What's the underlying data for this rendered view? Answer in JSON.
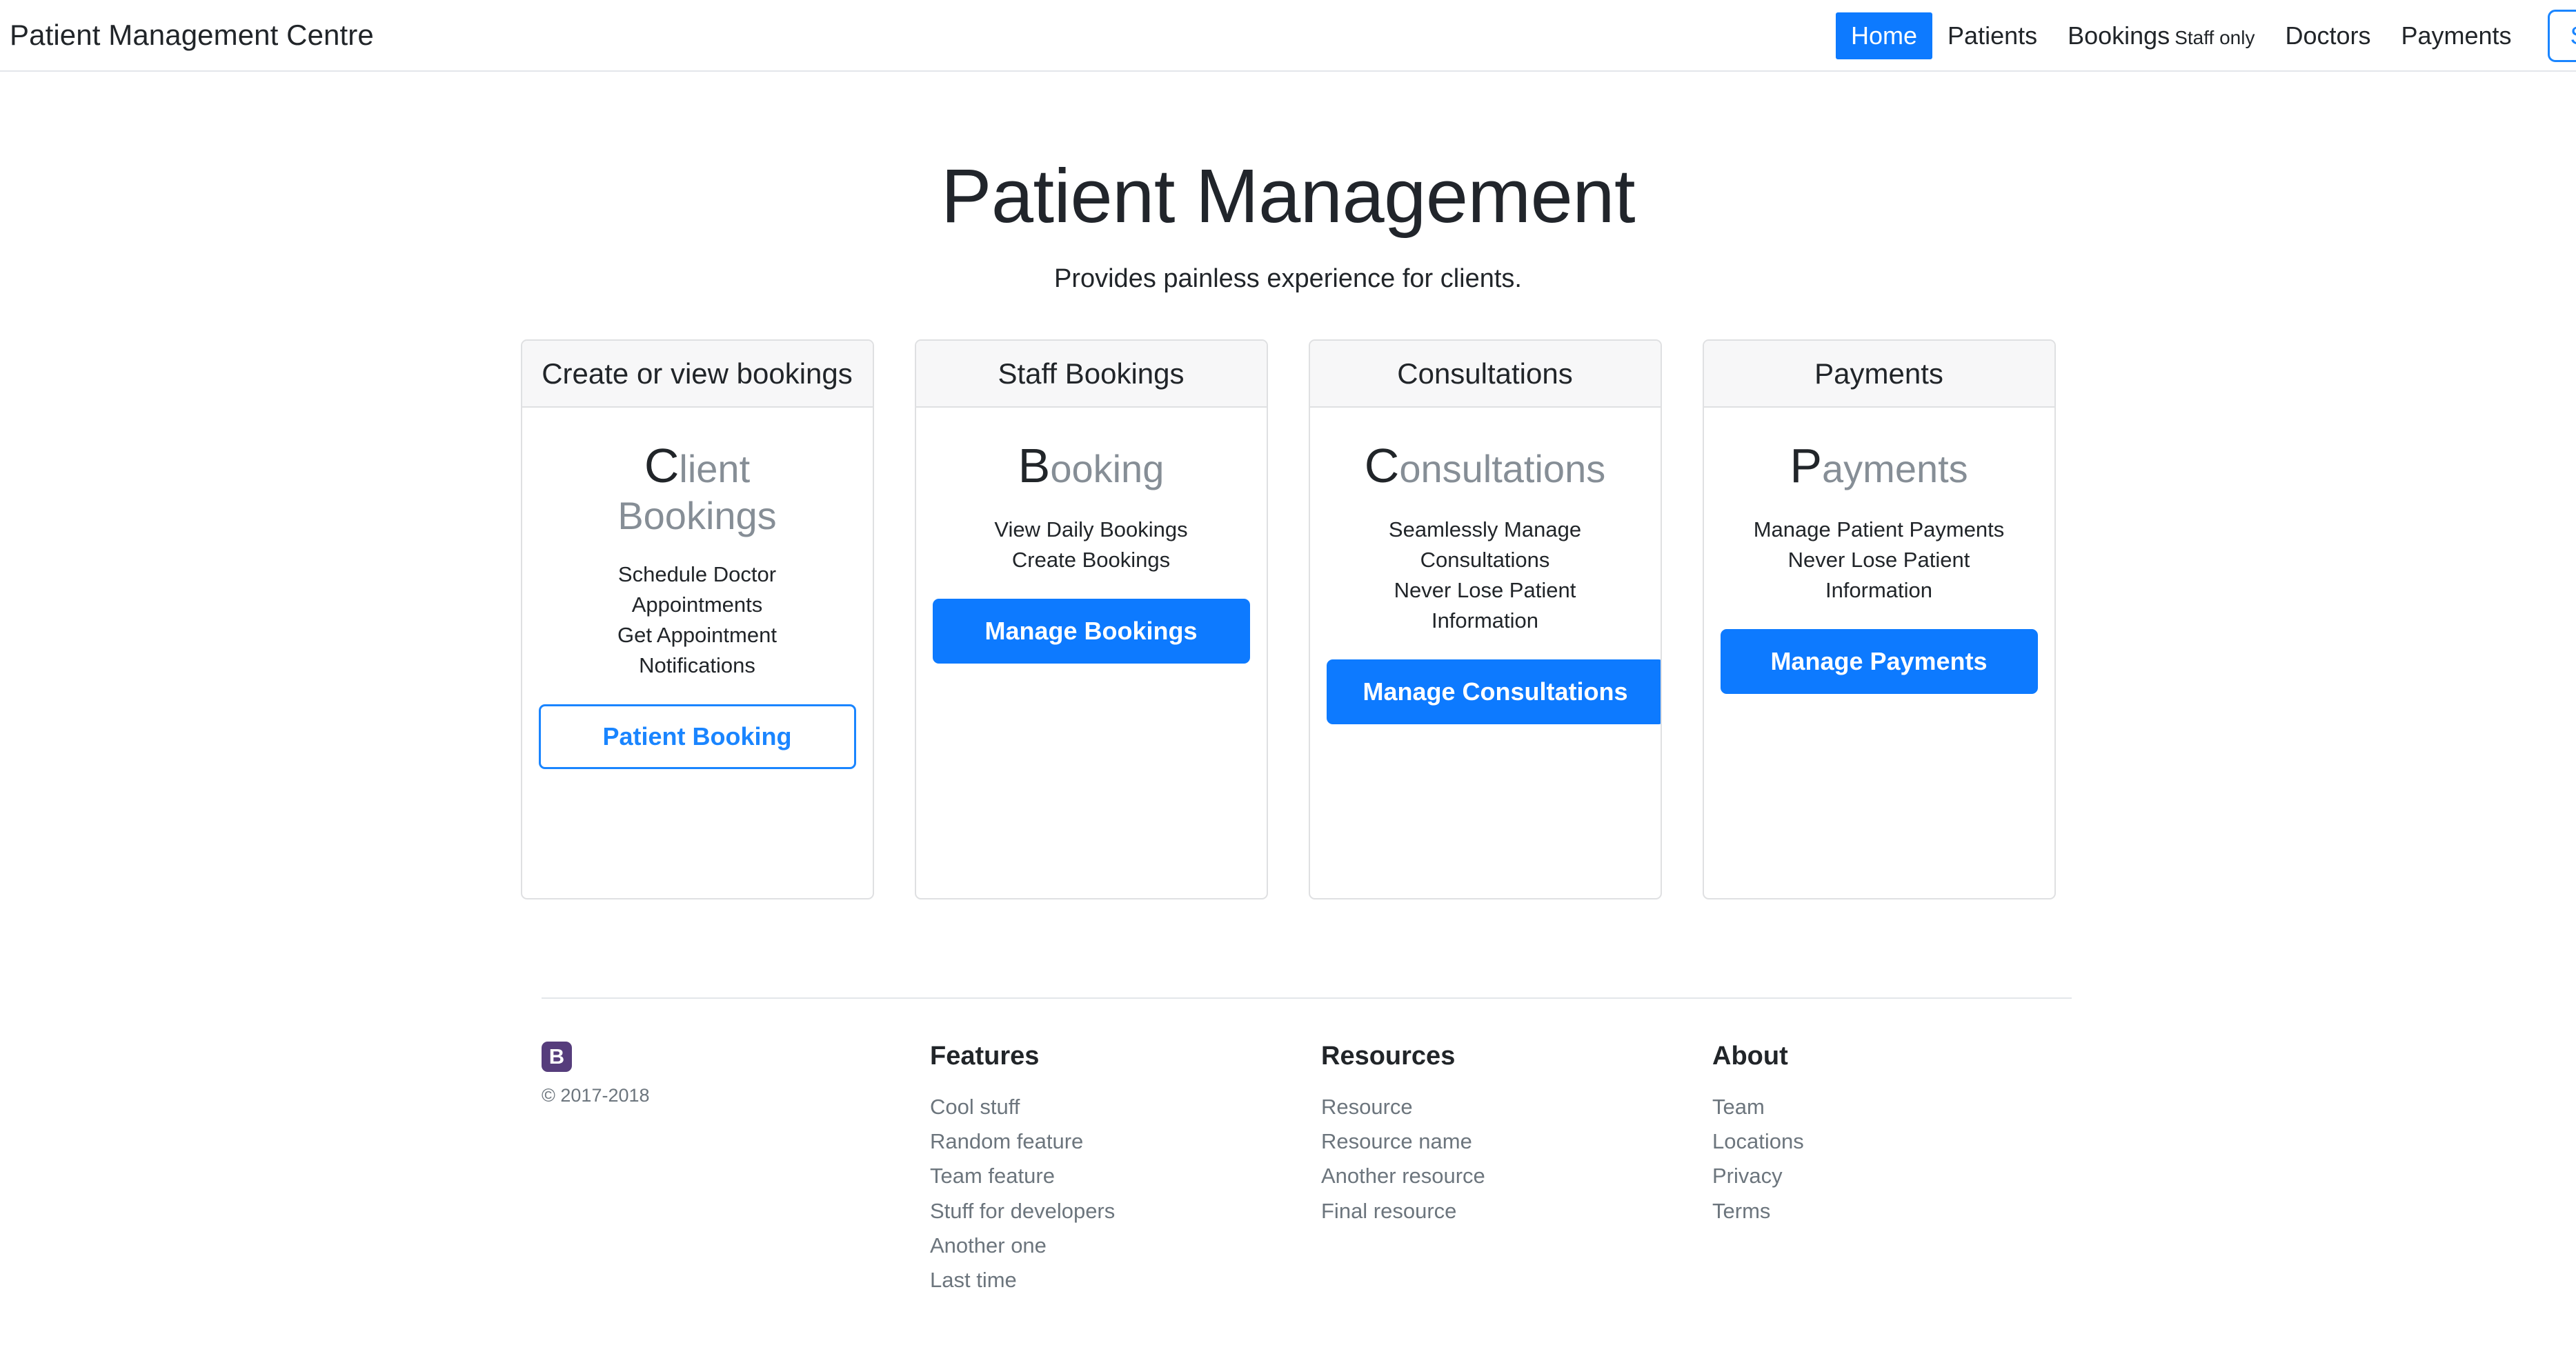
{
  "navbar": {
    "brand": "Patient Management Centre",
    "links": [
      {
        "label": "Home",
        "active": true
      },
      {
        "label": "Patients",
        "active": false
      },
      {
        "label": "Bookings",
        "sub": "Staff only",
        "active": false
      },
      {
        "label": "Doctors",
        "active": false
      },
      {
        "label": "Payments",
        "active": false
      }
    ],
    "signup_label": "Sign up"
  },
  "hero": {
    "title": "Patient Management",
    "subtitle": "Provides painless experience for clients."
  },
  "cards": [
    {
      "header": "Create or view bookings",
      "title_cap": "C",
      "title_rest": "lient",
      "title_line2": "Bookings",
      "items": [
        "Schedule Doctor",
        "Appointments",
        "Get Appointment",
        "Notifications"
      ],
      "button": "Patient Booking",
      "button_style": "outline"
    },
    {
      "header": "Staff Bookings",
      "title_cap": "B",
      "title_rest": "ooking",
      "title_line2": "",
      "items": [
        "View Daily Bookings",
        "Create Bookings"
      ],
      "button": "Manage Bookings",
      "button_style": "primary"
    },
    {
      "header": "Consultations",
      "title_cap": "C",
      "title_rest": "onsultations",
      "title_line2": "",
      "items": [
        "Seamlessly Manage",
        "Consultations",
        "Never Lose Patient",
        "Information"
      ],
      "button": "Manage Consultations",
      "button_style": "primary"
    },
    {
      "header": "Payments",
      "title_cap": "P",
      "title_rest": "ayments",
      "title_line2": "",
      "items": [
        "Manage Patient Payments",
        "Never Lose Patient",
        "Information"
      ],
      "button": "Manage Payments",
      "button_style": "primary"
    }
  ],
  "footer": {
    "logo_letter": "B",
    "copyright": "© 2017-2018",
    "columns": [
      {
        "heading": "Features",
        "links": [
          "Cool stuff",
          "Random feature",
          "Team feature",
          "Stuff for developers",
          "Another one",
          "Last time"
        ]
      },
      {
        "heading": "Resources",
        "links": [
          "Resource",
          "Resource name",
          "Another resource",
          "Final resource"
        ]
      },
      {
        "heading": "About",
        "links": [
          "Team",
          "Locations",
          "Privacy",
          "Terms"
        ]
      }
    ]
  },
  "colors": {
    "accent_blue": "#0d7aff",
    "link_blue": "#1a85ff",
    "brand_purple": "#563d7c",
    "muted_gray": "#6c757d"
  }
}
